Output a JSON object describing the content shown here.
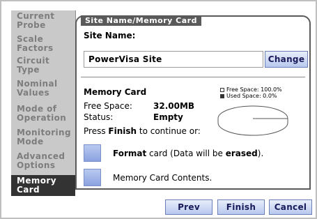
{
  "sidebar": {
    "items": [
      {
        "label": "Current\nProbe"
      },
      {
        "label": "Scale\nFactors"
      },
      {
        "label": "Circuit\nType"
      },
      {
        "label": "Nominal\nValues"
      },
      {
        "label": "Mode of\nOperation"
      },
      {
        "label": "Monitoring\nMode"
      },
      {
        "label": "Advanced\nOptions"
      },
      {
        "label": "Memory\nCard"
      }
    ]
  },
  "panel": {
    "title": "Site Name/Memory Card",
    "site_name_label": "Site Name:",
    "site_name_value": "PowerVisa Site",
    "change_label": "Change",
    "memory_card_heading": "Memory Card",
    "legend_free": "Free Space: 100.0%",
    "legend_used": "Used Space: 0.0%",
    "free_space_label": "Free Space:",
    "free_space_value": "32.00MB",
    "status_label": "Status:",
    "status_value": "Empty",
    "press_prefix": "Press ",
    "press_bold": "Finish",
    "press_suffix": " to continue or:",
    "format_bold": "Format",
    "format_mid": " card (Data will be ",
    "format_bold2": "erased",
    "format_end": ").",
    "contents_label": "Memory Card Contents."
  },
  "chart_data": {
    "type": "pie",
    "categories": [
      "Free Space",
      "Used Space"
    ],
    "values": [
      100.0,
      0.0
    ],
    "title": ""
  },
  "footer": {
    "prev_label": "Prev",
    "finish_label": "Finish",
    "cancel_label": "Cancel"
  },
  "colors": {
    "accent_button": "#b8c8ee",
    "sidebar_active": "#333333",
    "sidebar_bg": "#c9c9c9"
  }
}
